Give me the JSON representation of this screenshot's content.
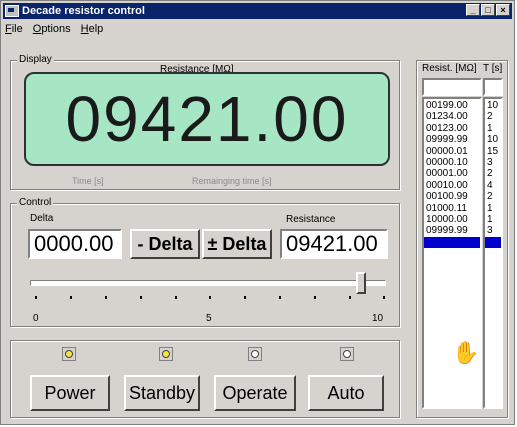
{
  "window": {
    "title": "Decade resistor control"
  },
  "menu": [
    {
      "label": "File",
      "accel": "F"
    },
    {
      "label": "Options",
      "accel": "O"
    },
    {
      "label": "Help",
      "accel": "H"
    }
  ],
  "display": {
    "group_label": "Display",
    "caption": "Resistance  [MΩ]",
    "value": "09421.00",
    "time_label": "Time [s]",
    "remaining_label": "Remainging time [s]"
  },
  "control": {
    "group_label": "Control",
    "delta_label": "Delta",
    "resistance_label": "Resistance",
    "delta_value": "0000.00",
    "resistance_value": "09421.00",
    "minus_delta": "- Delta",
    "plusminus_delta": "± Delta",
    "slider_min": "0",
    "slider_mid": "5",
    "slider_max": "10",
    "slider_value": 9.3
  },
  "modes": [
    {
      "label": "Power",
      "lamp": "on"
    },
    {
      "label": "Standby",
      "lamp": "on"
    },
    {
      "label": "Operate",
      "lamp": "off"
    },
    {
      "label": "Auto",
      "lamp": "off"
    }
  ],
  "list": {
    "header_res": "Resist. [MΩ]",
    "header_t": "T [s]",
    "resistances": [
      "00199.00",
      "01234.00",
      "00123.00",
      "09999.99",
      "00000.01",
      "00000.10",
      "00001.00",
      "00010.00",
      "00100.99",
      "01000.11",
      "10000.00",
      "09999.99"
    ],
    "times": [
      "10",
      "2",
      "1",
      "10",
      "15",
      "3",
      "2",
      "4",
      "2",
      "1",
      "1",
      "3"
    ]
  }
}
